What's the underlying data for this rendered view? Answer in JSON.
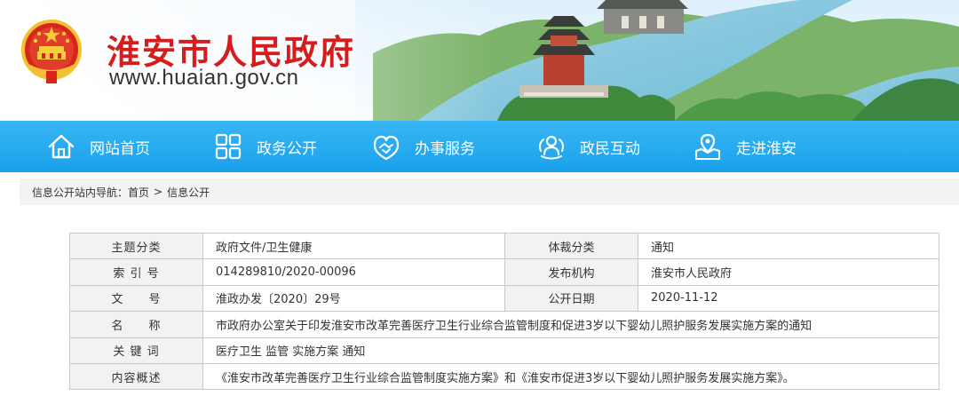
{
  "header": {
    "site_title": "淮安市人民政府",
    "site_url": "www.huaian.gov.cn"
  },
  "nav": {
    "items": [
      {
        "label": "网站首页",
        "icon": "home-icon"
      },
      {
        "label": "政务公开",
        "icon": "grid-icon"
      },
      {
        "label": "办事服务",
        "icon": "handshake-icon"
      },
      {
        "label": "政民互动",
        "icon": "people-icon"
      },
      {
        "label": "走进淮安",
        "icon": "map-pin-icon"
      }
    ]
  },
  "breadcrumb": {
    "prefix": "信息公开站内导航：",
    "home": "首页",
    "separator": ">",
    "current": "信息公开"
  },
  "info": {
    "rows": [
      {
        "label": "主题分类",
        "value": "政府文件/卫生健康",
        "label2": "体裁分类",
        "value2": "通知"
      },
      {
        "label": "索 引 号",
        "value": "014289810/2020-00096",
        "label2": "发布机构",
        "value2": "淮安市人民政府"
      },
      {
        "label": "文　　号",
        "value": "淮政办发〔2020〕29号",
        "label2": "公开日期",
        "value2": "2020-11-12"
      },
      {
        "label": "名　　称",
        "value": "市政府办公室关于印发淮安市改革完善医疗卫生行业综合监管制度和促进3岁以下婴幼儿照护服务发展实施方案的通知"
      },
      {
        "label": "关 键 词",
        "value": "医疗卫生 监管 实施方案 通知"
      },
      {
        "label": "内容概述",
        "value": "《淮安市改革完善医疗卫生行业综合监管制度实施方案》和《淮安市促进3岁以下婴幼儿照护服务发展实施方案》。"
      }
    ]
  },
  "colors": {
    "title_red": "#d61d1d",
    "nav_blue": "#1aa1ec",
    "label_bg": "#f2f2f2",
    "border": "#c9c9c9"
  }
}
